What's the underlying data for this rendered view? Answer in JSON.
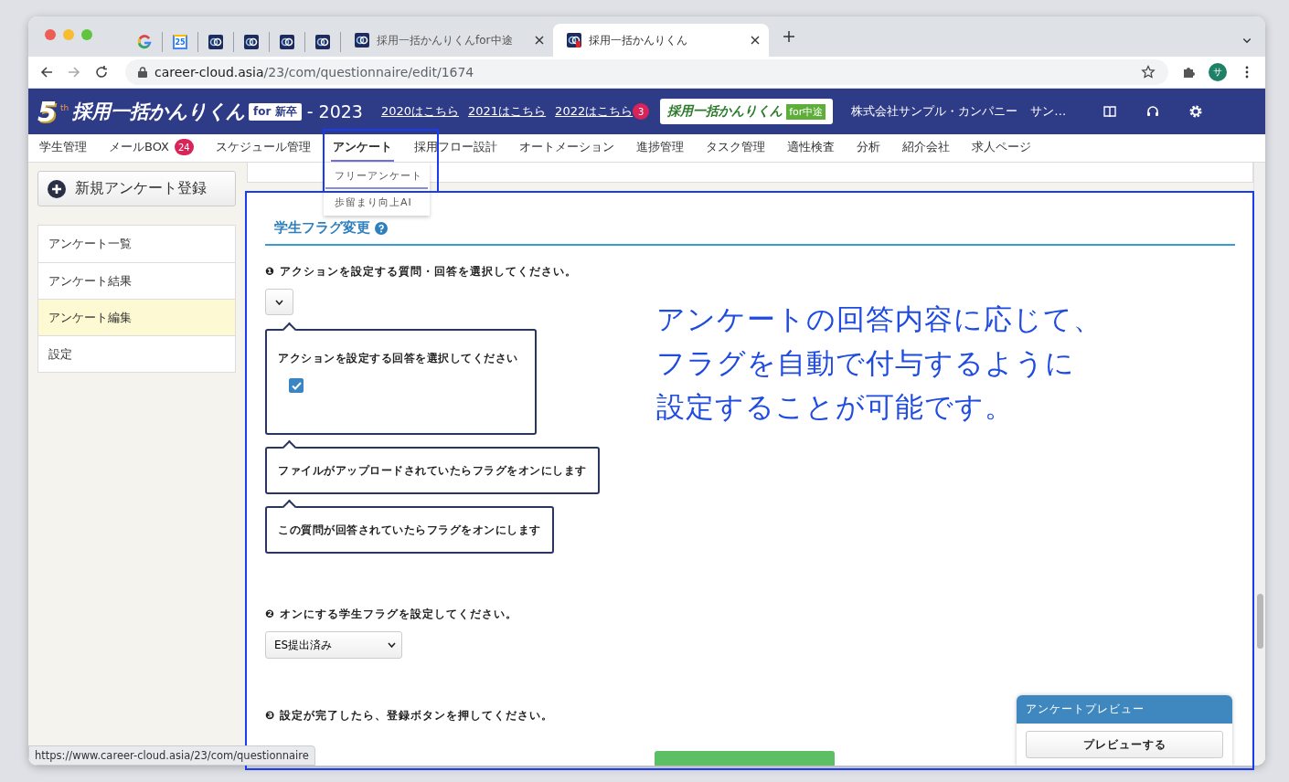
{
  "browser": {
    "tabs": [
      {
        "kind": "google",
        "selected": false
      },
      {
        "kind": "calendar",
        "icon_text": "25",
        "selected": false
      },
      {
        "kind": "app",
        "selected": false
      },
      {
        "kind": "app",
        "selected": false
      },
      {
        "kind": "app",
        "selected": false
      },
      {
        "kind": "app",
        "selected": false
      },
      {
        "kind": "app",
        "title": "採用一括かんりくんfor中途",
        "selected": false
      },
      {
        "kind": "app_alert",
        "title": "採用一括かんりくん",
        "selected": true
      }
    ],
    "url_host": "career-cloud.asia",
    "url_path": "/23/com/questionnaire/edit/1674",
    "profile_initial": "サ"
  },
  "header": {
    "logo_number": "5",
    "logo_suffix": "th",
    "logo_text": "採用一括かんりくん",
    "edition_badge": "for 新卒",
    "year": "- 2023",
    "year_links": [
      {
        "label": "2020はこちら"
      },
      {
        "label": "2021はこちら"
      },
      {
        "label": "2022はこちら",
        "badge": "3"
      }
    ],
    "sister_logo": {
      "text": "採用一括かんりくん",
      "tag": "for中途"
    },
    "company": "株式会社サンプル・カンパニー",
    "user": "サン…"
  },
  "nav": {
    "items": [
      {
        "label": "学生管理",
        "selected": false
      },
      {
        "label": "メールBOX",
        "badge": "24",
        "selected": false
      },
      {
        "label": "スケジュール管理",
        "selected": false
      },
      {
        "label": "アンケート",
        "selected": true
      },
      {
        "label": "採用フロー設計",
        "selected": false
      },
      {
        "label": "オートメーション",
        "selected": false
      },
      {
        "label": "進捗管理",
        "selected": false
      },
      {
        "label": "タスク管理",
        "selected": false
      },
      {
        "label": "適性検査",
        "selected": false
      },
      {
        "label": "分析",
        "selected": false
      },
      {
        "label": "紹介会社",
        "selected": false
      },
      {
        "label": "求人ページ",
        "selected": false
      }
    ],
    "dropdown": [
      {
        "label": "フリーアンケート",
        "selected": true
      },
      {
        "label": "歩留まり向上AI",
        "selected": false
      }
    ]
  },
  "sidebar": {
    "new_button": "新規アンケート登録",
    "items": [
      {
        "label": "アンケート一覧",
        "selected": false
      },
      {
        "label": "アンケート結果",
        "selected": false
      },
      {
        "label": "アンケート編集",
        "selected": true
      },
      {
        "label": "設定",
        "selected": false
      }
    ]
  },
  "form": {
    "title": "学生フラグ変更",
    "step1": {
      "number": "❶",
      "text": "アクションを設定する質問・回答を選択してください。"
    },
    "callouts": [
      {
        "kind": "checkbox",
        "text": "アクションを設定する回答を選択してください",
        "checked": true
      },
      {
        "kind": "text",
        "text": "ファイルがアップロードされていたらフラグをオンにします"
      },
      {
        "kind": "text",
        "text": "この質問が回答されていたらフラグをオンにします"
      }
    ],
    "step2": {
      "number": "❷",
      "text": "オンにする学生フラグを設定してください。",
      "value": "ES提出済み"
    },
    "step3": {
      "number": "❸",
      "text": "設定が完了したら、登録ボタンを押してください。"
    }
  },
  "annotation": {
    "lines": [
      "アンケートの回答内容に応じて、",
      "フラグを自動で付与するように",
      "設定することが可能です。"
    ]
  },
  "preview_panel": {
    "title": "アンケートプレビュー",
    "button": "プレビューする"
  },
  "status_url": "https://www.career-cloud.asia/23/com/questionnaire"
}
